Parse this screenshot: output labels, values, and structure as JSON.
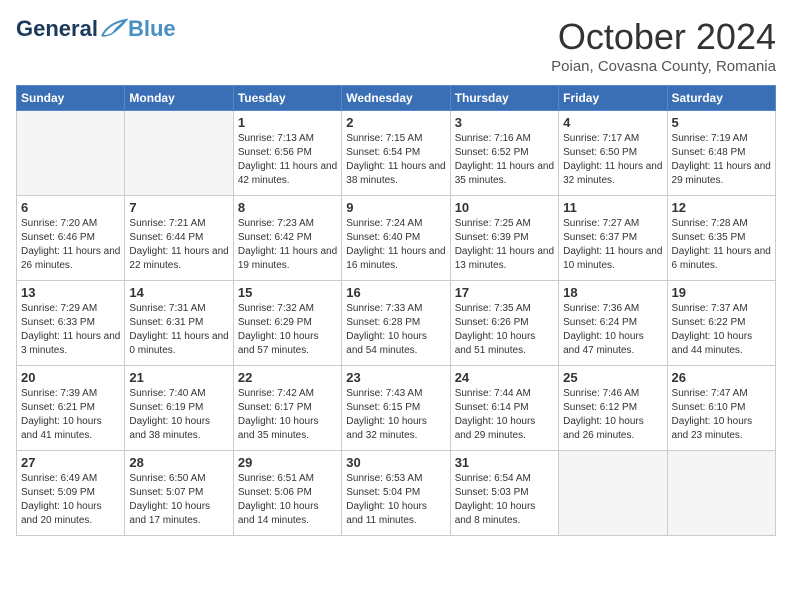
{
  "header": {
    "logo_general": "General",
    "logo_blue": "Blue",
    "month_title": "October 2024",
    "location": "Poian, Covasna County, Romania"
  },
  "weekdays": [
    "Sunday",
    "Monday",
    "Tuesday",
    "Wednesday",
    "Thursday",
    "Friday",
    "Saturday"
  ],
  "weeks": [
    [
      {
        "day": "",
        "empty": true
      },
      {
        "day": "",
        "empty": true
      },
      {
        "day": "1",
        "sunrise": "Sunrise: 7:13 AM",
        "sunset": "Sunset: 6:56 PM",
        "daylight": "Daylight: 11 hours and 42 minutes."
      },
      {
        "day": "2",
        "sunrise": "Sunrise: 7:15 AM",
        "sunset": "Sunset: 6:54 PM",
        "daylight": "Daylight: 11 hours and 38 minutes."
      },
      {
        "day": "3",
        "sunrise": "Sunrise: 7:16 AM",
        "sunset": "Sunset: 6:52 PM",
        "daylight": "Daylight: 11 hours and 35 minutes."
      },
      {
        "day": "4",
        "sunrise": "Sunrise: 7:17 AM",
        "sunset": "Sunset: 6:50 PM",
        "daylight": "Daylight: 11 hours and 32 minutes."
      },
      {
        "day": "5",
        "sunrise": "Sunrise: 7:19 AM",
        "sunset": "Sunset: 6:48 PM",
        "daylight": "Daylight: 11 hours and 29 minutes."
      }
    ],
    [
      {
        "day": "6",
        "sunrise": "Sunrise: 7:20 AM",
        "sunset": "Sunset: 6:46 PM",
        "daylight": "Daylight: 11 hours and 26 minutes."
      },
      {
        "day": "7",
        "sunrise": "Sunrise: 7:21 AM",
        "sunset": "Sunset: 6:44 PM",
        "daylight": "Daylight: 11 hours and 22 minutes."
      },
      {
        "day": "8",
        "sunrise": "Sunrise: 7:23 AM",
        "sunset": "Sunset: 6:42 PM",
        "daylight": "Daylight: 11 hours and 19 minutes."
      },
      {
        "day": "9",
        "sunrise": "Sunrise: 7:24 AM",
        "sunset": "Sunset: 6:40 PM",
        "daylight": "Daylight: 11 hours and 16 minutes."
      },
      {
        "day": "10",
        "sunrise": "Sunrise: 7:25 AM",
        "sunset": "Sunset: 6:39 PM",
        "daylight": "Daylight: 11 hours and 13 minutes."
      },
      {
        "day": "11",
        "sunrise": "Sunrise: 7:27 AM",
        "sunset": "Sunset: 6:37 PM",
        "daylight": "Daylight: 11 hours and 10 minutes."
      },
      {
        "day": "12",
        "sunrise": "Sunrise: 7:28 AM",
        "sunset": "Sunset: 6:35 PM",
        "daylight": "Daylight: 11 hours and 6 minutes."
      }
    ],
    [
      {
        "day": "13",
        "sunrise": "Sunrise: 7:29 AM",
        "sunset": "Sunset: 6:33 PM",
        "daylight": "Daylight: 11 hours and 3 minutes."
      },
      {
        "day": "14",
        "sunrise": "Sunrise: 7:31 AM",
        "sunset": "Sunset: 6:31 PM",
        "daylight": "Daylight: 11 hours and 0 minutes."
      },
      {
        "day": "15",
        "sunrise": "Sunrise: 7:32 AM",
        "sunset": "Sunset: 6:29 PM",
        "daylight": "Daylight: 10 hours and 57 minutes."
      },
      {
        "day": "16",
        "sunrise": "Sunrise: 7:33 AM",
        "sunset": "Sunset: 6:28 PM",
        "daylight": "Daylight: 10 hours and 54 minutes."
      },
      {
        "day": "17",
        "sunrise": "Sunrise: 7:35 AM",
        "sunset": "Sunset: 6:26 PM",
        "daylight": "Daylight: 10 hours and 51 minutes."
      },
      {
        "day": "18",
        "sunrise": "Sunrise: 7:36 AM",
        "sunset": "Sunset: 6:24 PM",
        "daylight": "Daylight: 10 hours and 47 minutes."
      },
      {
        "day": "19",
        "sunrise": "Sunrise: 7:37 AM",
        "sunset": "Sunset: 6:22 PM",
        "daylight": "Daylight: 10 hours and 44 minutes."
      }
    ],
    [
      {
        "day": "20",
        "sunrise": "Sunrise: 7:39 AM",
        "sunset": "Sunset: 6:21 PM",
        "daylight": "Daylight: 10 hours and 41 minutes."
      },
      {
        "day": "21",
        "sunrise": "Sunrise: 7:40 AM",
        "sunset": "Sunset: 6:19 PM",
        "daylight": "Daylight: 10 hours and 38 minutes."
      },
      {
        "day": "22",
        "sunrise": "Sunrise: 7:42 AM",
        "sunset": "Sunset: 6:17 PM",
        "daylight": "Daylight: 10 hours and 35 minutes."
      },
      {
        "day": "23",
        "sunrise": "Sunrise: 7:43 AM",
        "sunset": "Sunset: 6:15 PM",
        "daylight": "Daylight: 10 hours and 32 minutes."
      },
      {
        "day": "24",
        "sunrise": "Sunrise: 7:44 AM",
        "sunset": "Sunset: 6:14 PM",
        "daylight": "Daylight: 10 hours and 29 minutes."
      },
      {
        "day": "25",
        "sunrise": "Sunrise: 7:46 AM",
        "sunset": "Sunset: 6:12 PM",
        "daylight": "Daylight: 10 hours and 26 minutes."
      },
      {
        "day": "26",
        "sunrise": "Sunrise: 7:47 AM",
        "sunset": "Sunset: 6:10 PM",
        "daylight": "Daylight: 10 hours and 23 minutes."
      }
    ],
    [
      {
        "day": "27",
        "sunrise": "Sunrise: 6:49 AM",
        "sunset": "Sunset: 5:09 PM",
        "daylight": "Daylight: 10 hours and 20 minutes."
      },
      {
        "day": "28",
        "sunrise": "Sunrise: 6:50 AM",
        "sunset": "Sunset: 5:07 PM",
        "daylight": "Daylight: 10 hours and 17 minutes."
      },
      {
        "day": "29",
        "sunrise": "Sunrise: 6:51 AM",
        "sunset": "Sunset: 5:06 PM",
        "daylight": "Daylight: 10 hours and 14 minutes."
      },
      {
        "day": "30",
        "sunrise": "Sunrise: 6:53 AM",
        "sunset": "Sunset: 5:04 PM",
        "daylight": "Daylight: 10 hours and 11 minutes."
      },
      {
        "day": "31",
        "sunrise": "Sunrise: 6:54 AM",
        "sunset": "Sunset: 5:03 PM",
        "daylight": "Daylight: 10 hours and 8 minutes."
      },
      {
        "day": "",
        "empty": true
      },
      {
        "day": "",
        "empty": true
      }
    ]
  ]
}
